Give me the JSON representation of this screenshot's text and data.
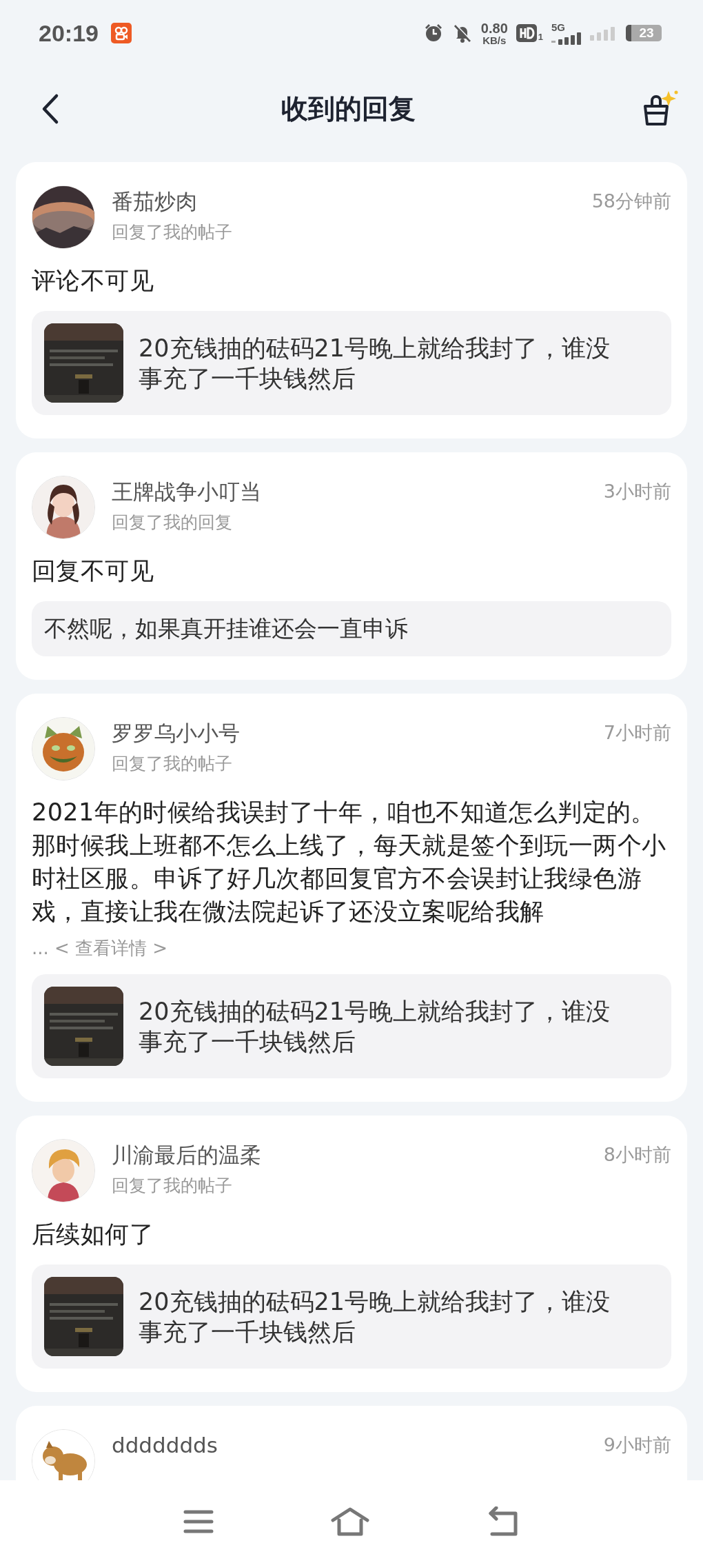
{
  "status_bar": {
    "time": "20:19",
    "net_speed": "0.80",
    "net_unit": "KB/s",
    "hd_sub": "1",
    "network": "5G",
    "battery": "23"
  },
  "header": {
    "title": "收到的回复"
  },
  "replies": [
    {
      "user": "番茄炒肉",
      "action": "回复了我的帖子",
      "time": "58分钟前",
      "text": "评论不可见",
      "quote": {
        "text": "20充钱抽的砝码21号晚上就给我封了，谁没事充了一千块钱然后"
      }
    },
    {
      "user": "王牌战争小叮当",
      "action": "回复了我的回复",
      "time": "3小时前",
      "text": "回复不可见",
      "quote": {
        "kind": "text",
        "text": "不然呢，如果真开挂谁还会一直申诉"
      }
    },
    {
      "user": "罗罗乌小小号",
      "action": "回复了我的帖子",
      "time": "7小时前",
      "text": "2021年的时候给我误封了十年，咱也不知道怎么判定的。那时候我上班都不怎么上线了，每天就是签个到玩一两个小时社区服。申诉了好几次都回复官方不会误封让我绿色游戏，直接让我在微法院起诉了还没立案呢给我解",
      "more": "... < 查看详情 >",
      "quote": {
        "text": "20充钱抽的砝码21号晚上就给我封了，谁没事充了一千块钱然后"
      }
    },
    {
      "user": "川渝最后的温柔",
      "action": "回复了我的帖子",
      "time": "8小时前",
      "text": "后续如何了",
      "quote": {
        "text": "20充钱抽的砝码21号晚上就给我封了，谁没事充了一千块钱然后"
      }
    },
    {
      "user": "ddddddds",
      "time": "9小时前"
    }
  ]
}
